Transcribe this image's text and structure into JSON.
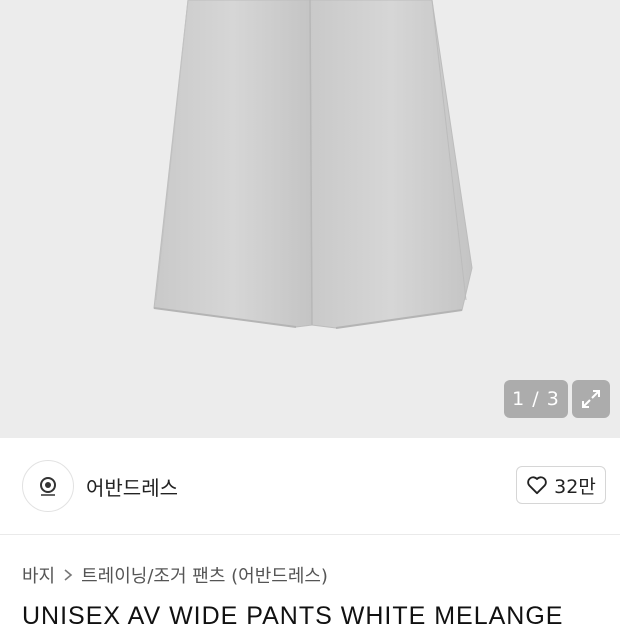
{
  "gallery": {
    "counter": "1 / 3",
    "expand_icon": "expand-icon"
  },
  "seller": {
    "name": "어반드레스",
    "avatar_icon": "brand-logo-icon"
  },
  "like": {
    "icon": "heart-icon",
    "count": "32만"
  },
  "breadcrumb": {
    "category": "바지",
    "separator_icon": "chevron-right-icon",
    "subcategory": "트레이닝/조거 팬츠 (어반드레스)"
  },
  "product": {
    "title": "UNISEX AV WIDE PANTS WHITE MELANGE"
  }
}
